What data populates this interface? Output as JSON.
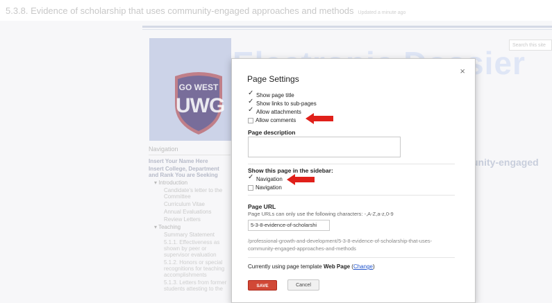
{
  "page": {
    "heading": "5.3.8. Evidence of scholarship that uses community-engaged approaches and methods",
    "updated": "Updated a minute ago"
  },
  "site": {
    "search_placeholder": "Search this site",
    "title": "Electronic Dossier",
    "logo_top": "GO WEST",
    "logo_main": "UWG",
    "faded_headline": "unity-engaged",
    "nav": {
      "heading": "Navigation",
      "items": [
        {
          "label": "Insert Your Name Here",
          "level": 0
        },
        {
          "label": "Insert College, Department and Rank You are Seeking",
          "level": 0
        },
        {
          "label": "▾ Introduction",
          "level": 1
        },
        {
          "label": "Candidate's letter to the Committee",
          "level": 2
        },
        {
          "label": "Curriculum Vitae",
          "level": 2
        },
        {
          "label": "Annual Evaluations",
          "level": 2
        },
        {
          "label": "Review Letters",
          "level": 2
        },
        {
          "label": "▾ Teaching",
          "level": 1
        },
        {
          "label": "Summary Statement",
          "level": 2
        },
        {
          "label": "5.1.1. Effectiveness as shown by peer or supervisor evaluation",
          "level": 3
        },
        {
          "label": "5.1.2. Honors or special recognitions for teaching accomplishments",
          "level": 3
        },
        {
          "label": "5.1.3. Letters from former students attesting to the",
          "level": 3
        }
      ]
    }
  },
  "dialog": {
    "title": "Page Settings",
    "close_glyph": "×",
    "options": [
      {
        "label": "Show page title",
        "checked": true
      },
      {
        "label": "Show links to sub-pages",
        "checked": true
      },
      {
        "label": "Allow attachments",
        "checked": true
      },
      {
        "label": "Allow comments",
        "checked": false
      }
    ],
    "description_label": "Page description",
    "sidebar_label": "Show this page in the sidebar:",
    "sidebar_options": [
      {
        "label": "Navigation",
        "checked": true
      },
      {
        "label": "Navigation",
        "checked": false
      }
    ],
    "url_label": "Page URL",
    "url_hint": "Page URLs can only use the following characters: -,A-Z,a-z,0-9",
    "url_value": "5-3-8-evidence-of-scholarshi",
    "full_path": "/professional-growth-and-development/5-3-8-evidence-of-scholarship-that-uses-community-engaged-approaches-and-methods",
    "template_prefix": "Currently using page template",
    "template_name": "Web Page",
    "template_change": "Change",
    "save_label": "SAVE",
    "cancel_label": "Cancel"
  },
  "colors": {
    "save_button": "#d14836",
    "arrow": "#e0201a",
    "link": "#2255cc"
  },
  "icons": {
    "arrows": [
      "red-arrow-icon",
      "red-arrow-icon"
    ],
    "close": "close-icon",
    "check": "checkmark-icon"
  }
}
